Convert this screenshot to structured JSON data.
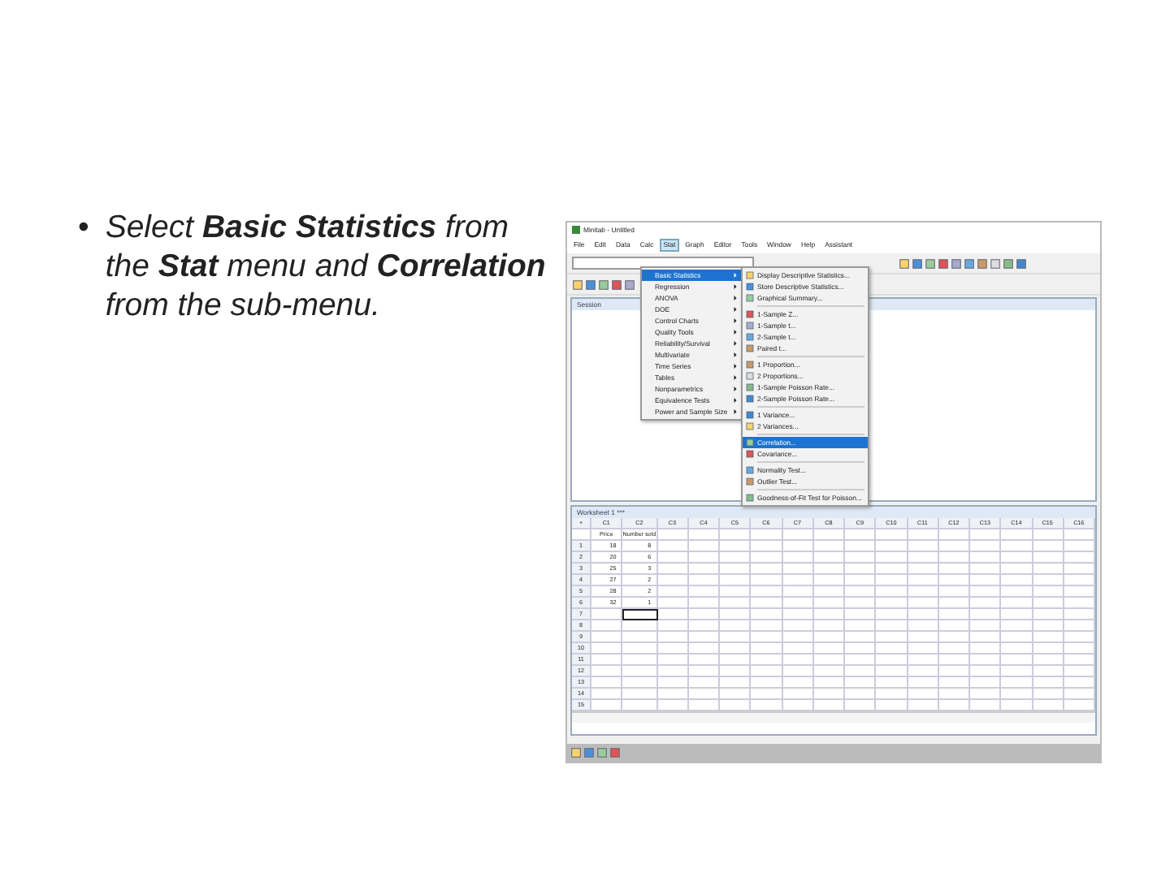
{
  "slide": {
    "bullet": {
      "marker": "•",
      "text": "Select **Basic Statistics** from the **Stat** menu and **Correlation** from the sub-menu."
    }
  },
  "app": {
    "title": "Minitab - Untitled",
    "menubar": [
      {
        "label": "File",
        "selected": false
      },
      {
        "label": "Edit",
        "selected": false
      },
      {
        "label": "Data",
        "selected": false
      },
      {
        "label": "Calc",
        "selected": false
      },
      {
        "label": "Stat",
        "selected": true
      },
      {
        "label": "Graph",
        "selected": false
      },
      {
        "label": "Editor",
        "selected": false
      },
      {
        "label": "Tools",
        "selected": false
      },
      {
        "label": "Window",
        "selected": false
      },
      {
        "label": "Help",
        "selected": false
      },
      {
        "label": "Assistant",
        "selected": false
      }
    ],
    "session": {
      "title": "Session"
    },
    "stat_menu": [
      {
        "label": "Basic Statistics",
        "selected": true
      },
      {
        "label": "Regression",
        "selected": false
      },
      {
        "label": "ANOVA",
        "selected": false
      },
      {
        "label": "DOE",
        "selected": false
      },
      {
        "label": "Control Charts",
        "selected": false
      },
      {
        "label": "Quality Tools",
        "selected": false
      },
      {
        "label": "Reliability/Survival",
        "selected": false
      },
      {
        "label": "Multivariate",
        "selected": false
      },
      {
        "label": "Time Series",
        "selected": false
      },
      {
        "label": "Tables",
        "selected": false
      },
      {
        "label": "Nonparametrics",
        "selected": false
      },
      {
        "label": "Equivalence Tests",
        "selected": false
      },
      {
        "label": "Power and Sample Size",
        "selected": false
      }
    ],
    "submenu": [
      [
        {
          "label": "Display Descriptive Statistics...",
          "selected": false
        },
        {
          "label": "Store Descriptive Statistics...",
          "selected": false
        },
        {
          "label": "Graphical Summary...",
          "selected": false
        }
      ],
      [
        {
          "label": "1-Sample Z...",
          "selected": false
        },
        {
          "label": "1-Sample t...",
          "selected": false
        },
        {
          "label": "2-Sample t...",
          "selected": false
        },
        {
          "label": "Paired t...",
          "selected": false
        }
      ],
      [
        {
          "label": "1 Proportion...",
          "selected": false
        },
        {
          "label": "2 Proportions...",
          "selected": false
        },
        {
          "label": "1-Sample Poisson Rate...",
          "selected": false
        },
        {
          "label": "2-Sample Poisson Rate...",
          "selected": false
        }
      ],
      [
        {
          "label": "1 Variance...",
          "selected": false
        },
        {
          "label": "2 Variances...",
          "selected": false
        }
      ],
      [
        {
          "label": "Correlation...",
          "selected": true
        },
        {
          "label": "Covariance...",
          "selected": false
        }
      ],
      [
        {
          "label": "Normality Test...",
          "selected": false
        },
        {
          "label": "Outlier Test...",
          "selected": false
        }
      ],
      [
        {
          "label": "Goodness-of-Fit Test for Poisson...",
          "selected": false
        }
      ]
    ],
    "worksheet": {
      "title": "Worksheet 1 ***",
      "corner": "+",
      "columns": [
        "C1",
        "C2",
        "C3",
        "C4",
        "C5",
        "C6",
        "C7",
        "C8",
        "C9",
        "C10",
        "C11",
        "C12",
        "C13",
        "C14",
        "C15",
        "C16"
      ],
      "names": [
        "Price",
        "Number sold"
      ],
      "rows": [
        {
          "num": "1",
          "cells": [
            "18",
            "8"
          ],
          "selected": false
        },
        {
          "num": "2",
          "cells": [
            "20",
            "6"
          ],
          "selected": false
        },
        {
          "num": "3",
          "cells": [
            "25",
            "3"
          ],
          "selected": false
        },
        {
          "num": "4",
          "cells": [
            "27",
            "2"
          ],
          "selected": false
        },
        {
          "num": "5",
          "cells": [
            "28",
            "2"
          ],
          "selected": false
        },
        {
          "num": "6",
          "cells": [
            "32",
            "1"
          ],
          "selected": false
        },
        {
          "num": "7",
          "cells": [],
          "selected": true
        },
        {
          "num": "8",
          "cells": [],
          "selected": false
        },
        {
          "num": "9",
          "cells": [],
          "selected": false
        },
        {
          "num": "10",
          "cells": [],
          "selected": false
        },
        {
          "num": "11",
          "cells": [],
          "selected": false
        },
        {
          "num": "12",
          "cells": [],
          "selected": false
        },
        {
          "num": "13",
          "cells": [],
          "selected": false
        },
        {
          "num": "14",
          "cells": [],
          "selected": false
        },
        {
          "num": "15",
          "cells": [],
          "selected": false
        }
      ]
    }
  }
}
